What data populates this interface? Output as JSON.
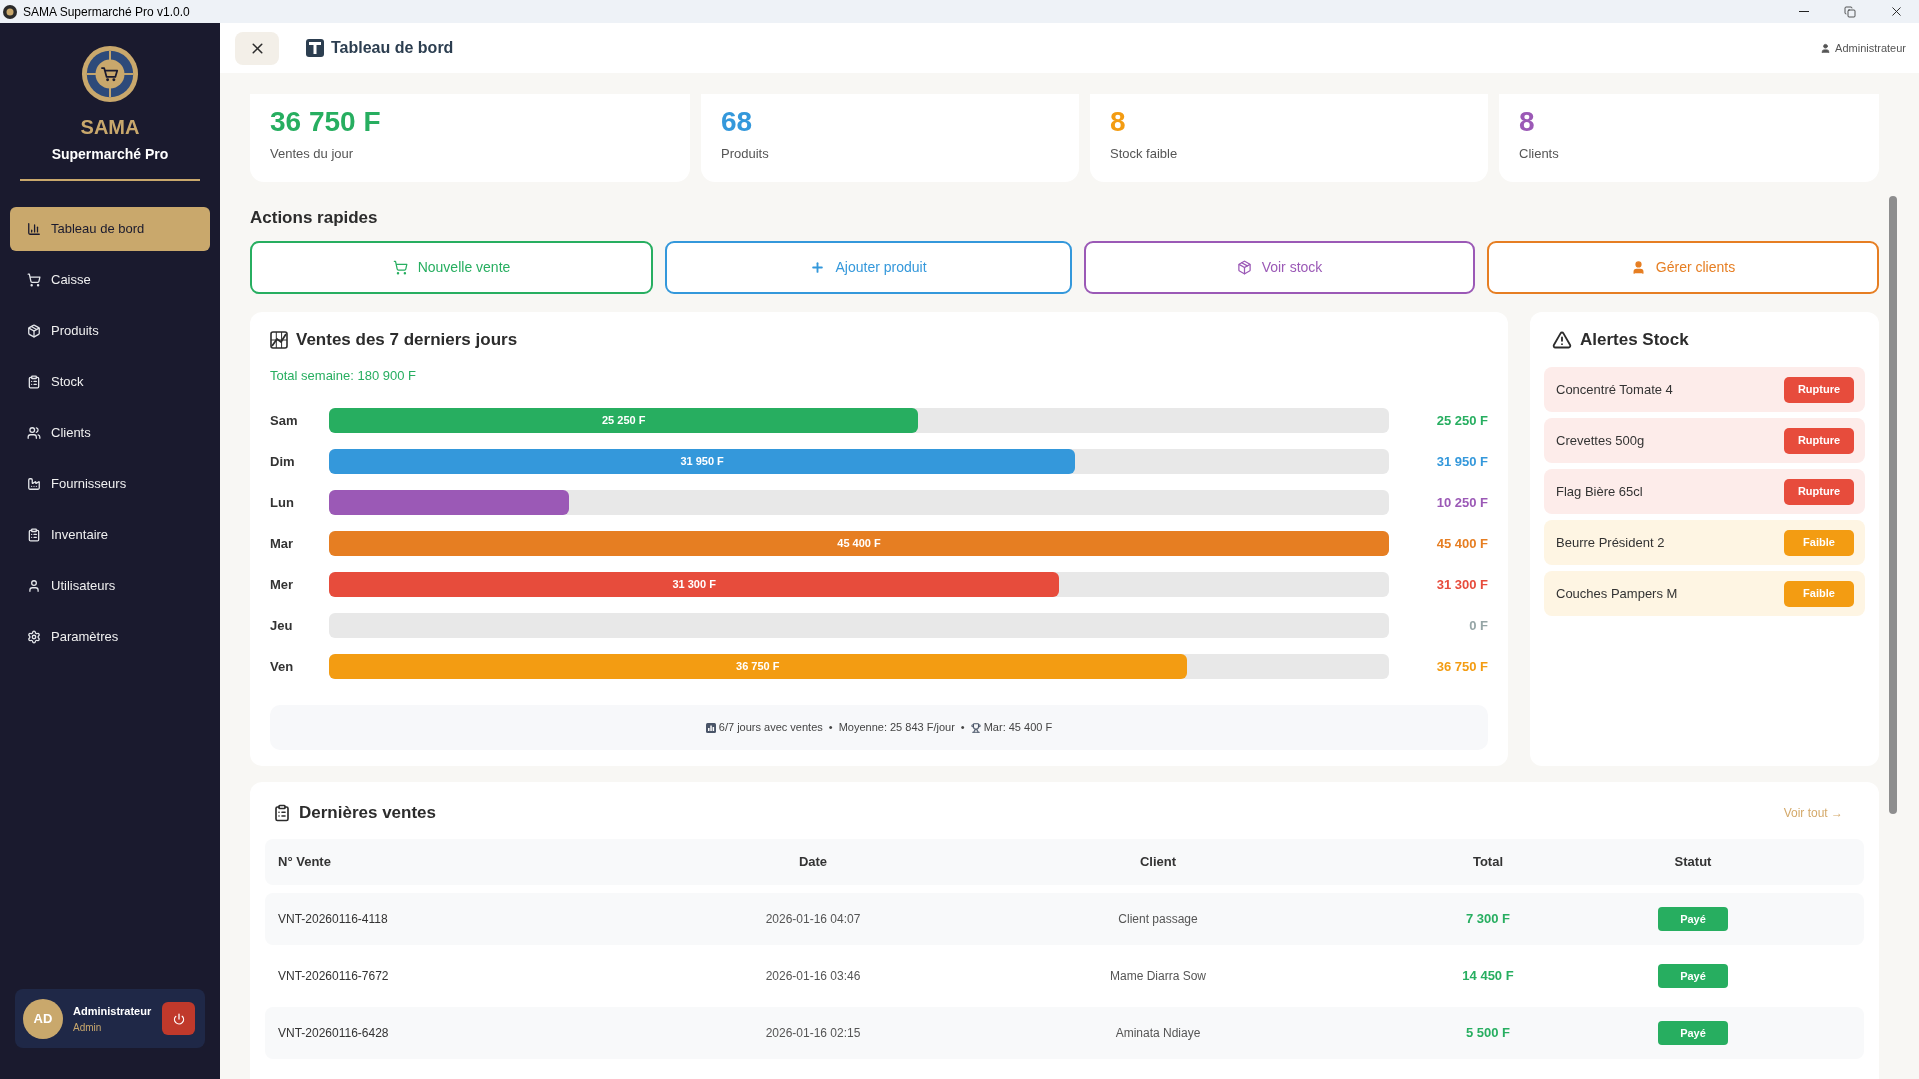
{
  "window": {
    "title": "SAMA Supermarché Pro v1.0.0"
  },
  "sidebar": {
    "brand": "SAMA",
    "subtitle": "Supermarché Pro",
    "items": [
      {
        "label": "Tableau de bord",
        "selected": true
      },
      {
        "label": "Caisse",
        "selected": false
      },
      {
        "label": "Produits",
        "selected": false
      },
      {
        "label": "Stock",
        "selected": false
      },
      {
        "label": "Clients",
        "selected": false
      },
      {
        "label": "Fournisseurs",
        "selected": false
      },
      {
        "label": "Inventaire",
        "selected": false
      },
      {
        "label": "Utilisateurs",
        "selected": false
      },
      {
        "label": "Paramètres",
        "selected": false
      }
    ],
    "user": {
      "initials": "AD",
      "name": "Administrateur",
      "role": "Admin"
    }
  },
  "header": {
    "title": "Tableau de bord",
    "user": "Administrateur"
  },
  "stats": [
    {
      "value": "36 750 F",
      "label": "Ventes du jour",
      "color": "#27ae60"
    },
    {
      "value": "68",
      "label": "Produits",
      "color": "#3498db"
    },
    {
      "value": "8",
      "label": "Stock faible",
      "color": "#f39c12"
    },
    {
      "value": "8",
      "label": "Clients",
      "color": "#9b59b6"
    }
  ],
  "quick_actions": {
    "title": "Actions rapides",
    "buttons": [
      {
        "label": "Nouvelle vente",
        "color": "#27ae60"
      },
      {
        "label": "Ajouter produit",
        "color": "#3498db"
      },
      {
        "label": "Voir stock",
        "color": "#9b59b6"
      },
      {
        "label": "Gérer clients",
        "color": "#e67e22"
      }
    ]
  },
  "sales_chart": {
    "title": "Ventes des 7 derniers jours",
    "total": "Total semaine: 180 900 F",
    "rows": [
      {
        "day": "Sam",
        "level": 0.556,
        "bar_label": "25 250 F",
        "value": "25 250 F",
        "color": "#27ae60"
      },
      {
        "day": "Dim",
        "level": 0.704,
        "bar_label": "31 950 F",
        "value": "31 950 F",
        "color": "#3498db"
      },
      {
        "day": "Lun",
        "level": 0.226,
        "value": "10 250 F",
        "color": "#9b59b6"
      },
      {
        "day": "Mar",
        "level": 1,
        "bar_label": "45 400 F",
        "value": "45 400 F",
        "color": "#e67e22"
      },
      {
        "day": "Mer",
        "level": 0.689,
        "bar_label": "31 300 F",
        "value": "31 300 F",
        "color": "#e74c3c"
      },
      {
        "day": "Jeu",
        "value": "0 F",
        "color": "#95a5a6"
      },
      {
        "day": "Ven",
        "level": 0.809,
        "bar_label": "36 750 F",
        "value": "36 750 F",
        "color": "#f39c12"
      }
    ],
    "summary": [
      {
        "kind": "days",
        "text": "6/7 jours avec ventes"
      },
      {
        "kind": "separator",
        "text": "•"
      },
      {
        "kind": "average",
        "text": "Moyenne: 25 843 F/jour"
      },
      {
        "kind": "separator",
        "text": "•"
      },
      {
        "kind": "best",
        "text": "Mar: 45 400 F"
      }
    ]
  },
  "stock_alerts": {
    "title": "Alertes Stock",
    "items": [
      {
        "name": "Concentré Tomate 4",
        "kind": "rupture",
        "badge": "Rupture"
      },
      {
        "name": "Crevettes 500g",
        "kind": "rupture",
        "badge": "Rupture"
      },
      {
        "name": "Flag Bière 65cl",
        "kind": "rupture",
        "badge": "Rupture"
      },
      {
        "name": "Beurre Président 2",
        "kind": "faible",
        "badge": "Faible"
      },
      {
        "name": "Couches Pampers M",
        "kind": "faible",
        "badge": "Faible"
      }
    ]
  },
  "recent_sales": {
    "title": "Dernières ventes",
    "link": "Voir tout →",
    "columns": [
      "N° Vente",
      "Date",
      "Client",
      "Total",
      "Statut"
    ],
    "rows": [
      {
        "number": "VNT-20260116-4118",
        "date": "2026-01-16 04:07",
        "client": "Client passage",
        "total": "7 300 F",
        "status": "Payé"
      },
      {
        "number": "VNT-20260116-7672",
        "date": "2026-01-16 03:46",
        "client": "Mame Diarra Sow",
        "total": "14 450 F",
        "status": "Payé"
      },
      {
        "number": "VNT-20260116-6428",
        "date": "2026-01-16 02:15",
        "client": "Aminata Ndiaye",
        "total": "5 500 F",
        "status": "Payé"
      }
    ]
  }
}
